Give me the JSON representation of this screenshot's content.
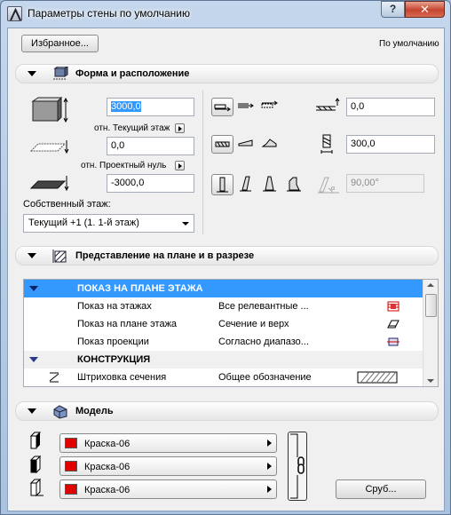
{
  "window": {
    "title": "Параметры стены по умолчанию",
    "help_label": "?",
    "close_label": "✕"
  },
  "top": {
    "favorites_label": "Избранное...",
    "default_label": "По умолчанию"
  },
  "sections": {
    "geometry": "Форма и расположение",
    "plan": "Представление на плане и в разрезе",
    "model": "Модель"
  },
  "geometry": {
    "height_value": "3000,0",
    "height_ref_label": "отн. Текущий этаж",
    "base_offset_value": "0,0",
    "base_ref_label": "отн. Проектный нуль",
    "bottom_value": "-3000,0",
    "home_story_label": "Собственный этаж:",
    "home_story_value": "Текущий +1 (1. 1-й этаж)",
    "offset_value": "0,0",
    "thickness_value": "300,0",
    "angle_value": "90,00°"
  },
  "plan_table": {
    "rows": [
      {
        "type": "group-selected",
        "label": "ПОКАЗ НА ПЛАНЕ ЭТАЖА",
        "value": ""
      },
      {
        "type": "item",
        "label": "Показ на этажах",
        "value": "Все релевантные ...",
        "icon": "stories-icon"
      },
      {
        "type": "item",
        "label": "Показ на плане этажа",
        "value": "Сечение и верх",
        "icon": "cut-top-icon"
      },
      {
        "type": "item",
        "label": "Показ проекции",
        "value": "Согласно диапазо...",
        "icon": "projection-icon"
      },
      {
        "type": "group",
        "label": "КОНСТРУКЦИЯ",
        "value": ""
      },
      {
        "type": "item",
        "label": "Штриховка сечения",
        "value": "Общее обозначение",
        "icon": "hatch-preview"
      }
    ]
  },
  "model": {
    "paints": [
      "Краска-06",
      "Краска-06",
      "Краска-06"
    ],
    "paint_color": "#e00000",
    "log_button_label": "Сруб..."
  },
  "colors": {
    "selected_row": "#3399ff",
    "close_button": "#c5452f"
  }
}
